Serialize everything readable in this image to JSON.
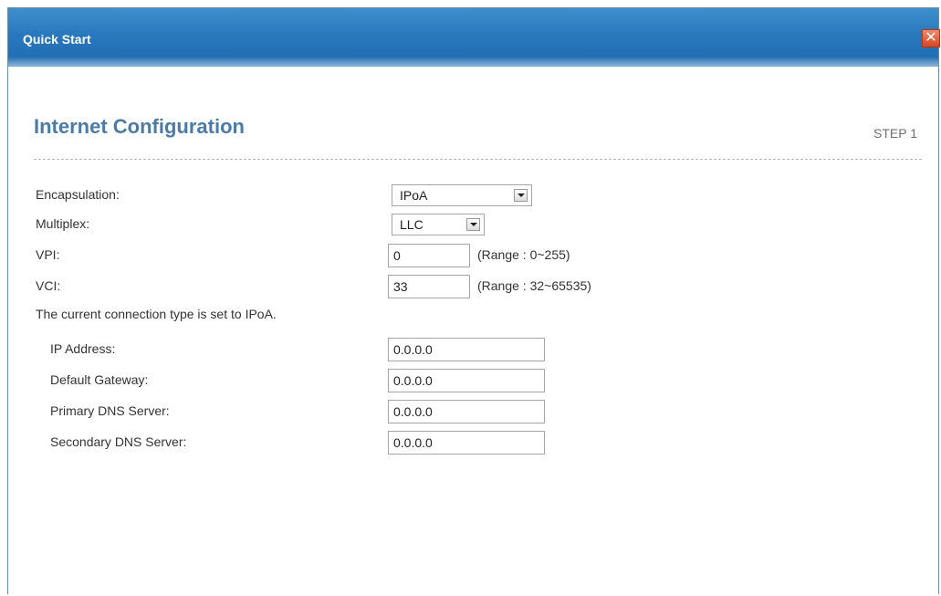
{
  "dialog": {
    "title": "Quick Start",
    "close_symbol": "✕",
    "section_title": "Internet Configuration",
    "step": "STEP 1"
  },
  "form": {
    "encapsulation": {
      "label": "Encapsulation:",
      "value": "IPoA"
    },
    "multiplex": {
      "label": "Multiplex:",
      "value": "LLC"
    },
    "vpi": {
      "label": "VPI:",
      "value": "0",
      "range": "(Range : 0~255)"
    },
    "vci": {
      "label": "VCI:",
      "value": "33",
      "range": "(Range : 32~65535)"
    },
    "connection_note": "The current connection type is set to IPoA.",
    "ip_address": {
      "label": "IP Address:",
      "value": "0.0.0.0"
    },
    "default_gateway": {
      "label": "Default Gateway:",
      "value": "0.0.0.0"
    },
    "primary_dns": {
      "label": "Primary DNS Server:",
      "value": "0.0.0.0"
    },
    "secondary_dns": {
      "label": "Secondary DNS Server:",
      "value": "0.0.0.0"
    }
  },
  "icons": {
    "close": "close-icon",
    "dropdown": "chevron-down-icon"
  }
}
